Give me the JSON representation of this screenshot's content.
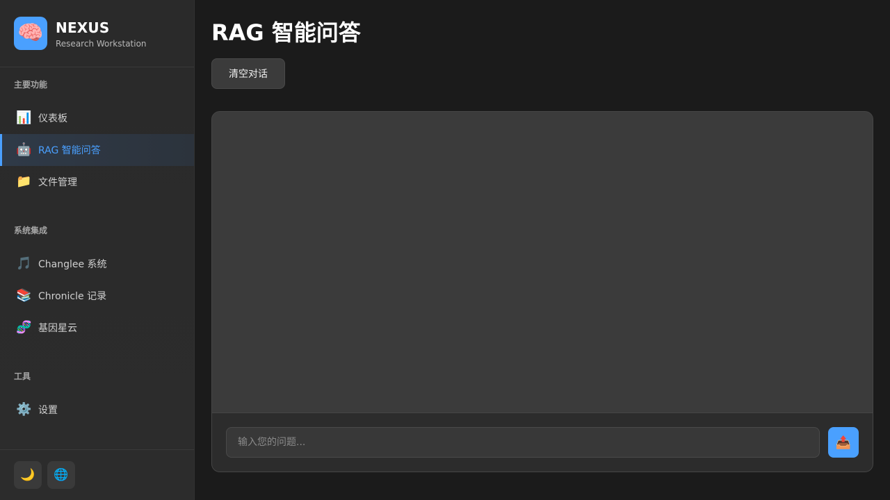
{
  "brand": {
    "logo_icon": "🧠",
    "name": "NEXUS",
    "subtitle": "Research Workstation"
  },
  "sidebar": {
    "sections": [
      {
        "title": "主要功能",
        "items": [
          {
            "icon": "📊",
            "icon_name": "bar-chart-icon",
            "label": "仪表板",
            "active": false
          },
          {
            "icon": "🤖",
            "icon_name": "robot-icon",
            "label": "RAG 智能问答",
            "active": true
          },
          {
            "icon": "📁",
            "icon_name": "folder-icon",
            "label": "文件管理",
            "active": false
          }
        ]
      },
      {
        "title": "系统集成",
        "items": [
          {
            "icon": "🎵",
            "icon_name": "music-note-icon",
            "label": "Changlee 系统",
            "active": false
          },
          {
            "icon": "📚",
            "icon_name": "books-icon",
            "label": "Chronicle 记录",
            "active": false
          },
          {
            "icon": "🧬",
            "icon_name": "dna-icon",
            "label": "基因星云",
            "active": false
          }
        ]
      },
      {
        "title": "工具",
        "items": [
          {
            "icon": "⚙️",
            "icon_name": "gear-icon",
            "label": "设置",
            "active": false
          }
        ]
      }
    ],
    "footer": {
      "theme_icon": "🌙",
      "language_icon": "🌐"
    }
  },
  "main": {
    "title": "RAG 智能问答",
    "clear_label": "清空对话",
    "input": {
      "value": "",
      "placeholder": "输入您的问题..."
    },
    "send_icon": "📤"
  },
  "colors": {
    "accent": "#4aa0ff",
    "background": "#1b1b1b",
    "sidebar": "#2a2a2a",
    "panel": "#3b3b3b"
  }
}
